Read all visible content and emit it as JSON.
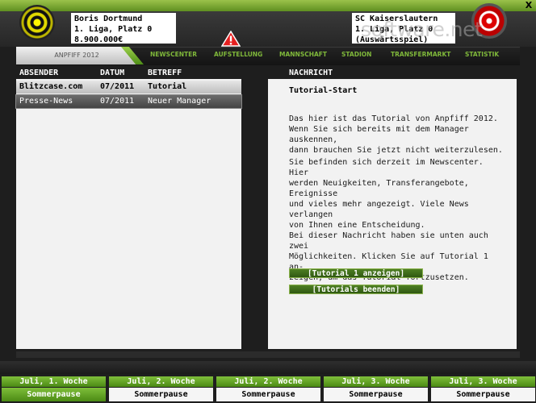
{
  "window": {
    "close_label": "X"
  },
  "header": {
    "club_left": {
      "name": "Boris Dortmund",
      "league": "1. Liga, Platz 0",
      "money": "8.900.000€"
    },
    "club_right": {
      "name": "SC Kaiserslautern",
      "league": "1. Liga, Platz 0",
      "match": "(Auswärtsspiel)"
    },
    "watermark": "software.net"
  },
  "nav": {
    "brand": "ANPFIFF 2012",
    "items": [
      "NEWSCENTER",
      "AUFSTELLUNG",
      "MANNSCHAFT",
      "STADION",
      "TRANSFERMARKT",
      "STATISTIK"
    ]
  },
  "list": {
    "headers": {
      "sender": "ABSENDER",
      "date": "DATUM",
      "subject": "BETREFF"
    },
    "rows": [
      {
        "sender": "Blitzcase.com",
        "date": "07/2011",
        "subject": "Tutorial"
      },
      {
        "sender": "Presse-News",
        "date": "07/2011",
        "subject": "Neuer Manager"
      }
    ]
  },
  "message": {
    "header": "NACHRICHT",
    "title": "Tutorial-Start",
    "lines1": [
      "Das hier ist das Tutorial von Anpfiff 2012.",
      "Wenn Sie sich bereits mit dem Manager auskennen,",
      "dann brauchen Sie jetzt nicht weiterzulesen."
    ],
    "lines2": [
      "Sie befinden sich derzeit im Newscenter. Hier",
      "werden Neuigkeiten, Transferangebote, Ereignisse",
      "und vieles mehr angezeigt. Viele News verlangen",
      "von Ihnen eine Entscheidung.",
      "Bei dieser Nachricht haben sie unten auch zwei",
      "Möglichkeiten. Klicken Sie auf Tutorial 1 an-",
      "zeigen, um das Tutorial fortzusetzen."
    ],
    "button1": "[Tutorial 1 anzeigen]",
    "button2": "[Tutorials beenden]"
  },
  "weeks": [
    {
      "week": "Juli, 1. Woche",
      "status": "Sommerpause"
    },
    {
      "week": "Juli, 2. Woche",
      "status": "Sommerpause"
    },
    {
      "week": "Juli, 2. Woche",
      "status": "Sommerpause"
    },
    {
      "week": "Juli, 3. Woche",
      "status": "Sommerpause"
    },
    {
      "week": "Juli, 3. Woche",
      "status": "Sommerpause"
    }
  ],
  "colors": {
    "accent_green": "#7fb83a",
    "panel_bg": "#f2f2f2",
    "app_bg": "#1e1e1e"
  }
}
